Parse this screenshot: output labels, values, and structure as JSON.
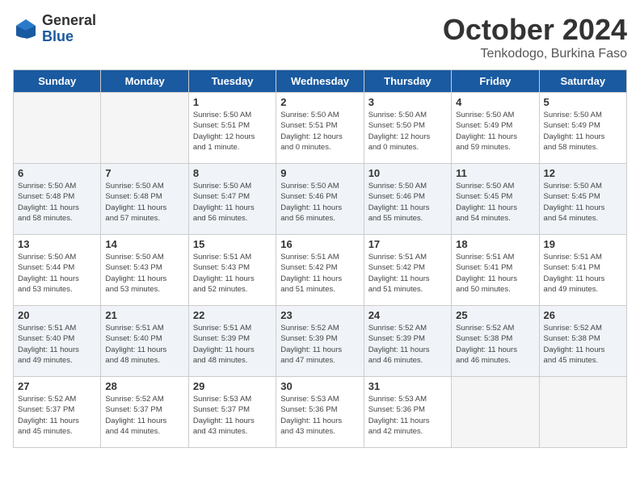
{
  "logo": {
    "general": "General",
    "blue": "Blue"
  },
  "title": "October 2024",
  "subtitle": "Tenkodogo, Burkina Faso",
  "days_header": [
    "Sunday",
    "Monday",
    "Tuesday",
    "Wednesday",
    "Thursday",
    "Friday",
    "Saturday"
  ],
  "weeks": [
    {
      "shaded": false,
      "days": [
        {
          "num": "",
          "info": ""
        },
        {
          "num": "",
          "info": ""
        },
        {
          "num": "1",
          "info": "Sunrise: 5:50 AM\nSunset: 5:51 PM\nDaylight: 12 hours\nand 1 minute."
        },
        {
          "num": "2",
          "info": "Sunrise: 5:50 AM\nSunset: 5:51 PM\nDaylight: 12 hours\nand 0 minutes."
        },
        {
          "num": "3",
          "info": "Sunrise: 5:50 AM\nSunset: 5:50 PM\nDaylight: 12 hours\nand 0 minutes."
        },
        {
          "num": "4",
          "info": "Sunrise: 5:50 AM\nSunset: 5:49 PM\nDaylight: 11 hours\nand 59 minutes."
        },
        {
          "num": "5",
          "info": "Sunrise: 5:50 AM\nSunset: 5:49 PM\nDaylight: 11 hours\nand 58 minutes."
        }
      ]
    },
    {
      "shaded": true,
      "days": [
        {
          "num": "6",
          "info": "Sunrise: 5:50 AM\nSunset: 5:48 PM\nDaylight: 11 hours\nand 58 minutes."
        },
        {
          "num": "7",
          "info": "Sunrise: 5:50 AM\nSunset: 5:48 PM\nDaylight: 11 hours\nand 57 minutes."
        },
        {
          "num": "8",
          "info": "Sunrise: 5:50 AM\nSunset: 5:47 PM\nDaylight: 11 hours\nand 56 minutes."
        },
        {
          "num": "9",
          "info": "Sunrise: 5:50 AM\nSunset: 5:46 PM\nDaylight: 11 hours\nand 56 minutes."
        },
        {
          "num": "10",
          "info": "Sunrise: 5:50 AM\nSunset: 5:46 PM\nDaylight: 11 hours\nand 55 minutes."
        },
        {
          "num": "11",
          "info": "Sunrise: 5:50 AM\nSunset: 5:45 PM\nDaylight: 11 hours\nand 54 minutes."
        },
        {
          "num": "12",
          "info": "Sunrise: 5:50 AM\nSunset: 5:45 PM\nDaylight: 11 hours\nand 54 minutes."
        }
      ]
    },
    {
      "shaded": false,
      "days": [
        {
          "num": "13",
          "info": "Sunrise: 5:50 AM\nSunset: 5:44 PM\nDaylight: 11 hours\nand 53 minutes."
        },
        {
          "num": "14",
          "info": "Sunrise: 5:50 AM\nSunset: 5:43 PM\nDaylight: 11 hours\nand 53 minutes."
        },
        {
          "num": "15",
          "info": "Sunrise: 5:51 AM\nSunset: 5:43 PM\nDaylight: 11 hours\nand 52 minutes."
        },
        {
          "num": "16",
          "info": "Sunrise: 5:51 AM\nSunset: 5:42 PM\nDaylight: 11 hours\nand 51 minutes."
        },
        {
          "num": "17",
          "info": "Sunrise: 5:51 AM\nSunset: 5:42 PM\nDaylight: 11 hours\nand 51 minutes."
        },
        {
          "num": "18",
          "info": "Sunrise: 5:51 AM\nSunset: 5:41 PM\nDaylight: 11 hours\nand 50 minutes."
        },
        {
          "num": "19",
          "info": "Sunrise: 5:51 AM\nSunset: 5:41 PM\nDaylight: 11 hours\nand 49 minutes."
        }
      ]
    },
    {
      "shaded": true,
      "days": [
        {
          "num": "20",
          "info": "Sunrise: 5:51 AM\nSunset: 5:40 PM\nDaylight: 11 hours\nand 49 minutes."
        },
        {
          "num": "21",
          "info": "Sunrise: 5:51 AM\nSunset: 5:40 PM\nDaylight: 11 hours\nand 48 minutes."
        },
        {
          "num": "22",
          "info": "Sunrise: 5:51 AM\nSunset: 5:39 PM\nDaylight: 11 hours\nand 48 minutes."
        },
        {
          "num": "23",
          "info": "Sunrise: 5:52 AM\nSunset: 5:39 PM\nDaylight: 11 hours\nand 47 minutes."
        },
        {
          "num": "24",
          "info": "Sunrise: 5:52 AM\nSunset: 5:39 PM\nDaylight: 11 hours\nand 46 minutes."
        },
        {
          "num": "25",
          "info": "Sunrise: 5:52 AM\nSunset: 5:38 PM\nDaylight: 11 hours\nand 46 minutes."
        },
        {
          "num": "26",
          "info": "Sunrise: 5:52 AM\nSunset: 5:38 PM\nDaylight: 11 hours\nand 45 minutes."
        }
      ]
    },
    {
      "shaded": false,
      "days": [
        {
          "num": "27",
          "info": "Sunrise: 5:52 AM\nSunset: 5:37 PM\nDaylight: 11 hours\nand 45 minutes."
        },
        {
          "num": "28",
          "info": "Sunrise: 5:52 AM\nSunset: 5:37 PM\nDaylight: 11 hours\nand 44 minutes."
        },
        {
          "num": "29",
          "info": "Sunrise: 5:53 AM\nSunset: 5:37 PM\nDaylight: 11 hours\nand 43 minutes."
        },
        {
          "num": "30",
          "info": "Sunrise: 5:53 AM\nSunset: 5:36 PM\nDaylight: 11 hours\nand 43 minutes."
        },
        {
          "num": "31",
          "info": "Sunrise: 5:53 AM\nSunset: 5:36 PM\nDaylight: 11 hours\nand 42 minutes."
        },
        {
          "num": "",
          "info": ""
        },
        {
          "num": "",
          "info": ""
        }
      ]
    }
  ]
}
